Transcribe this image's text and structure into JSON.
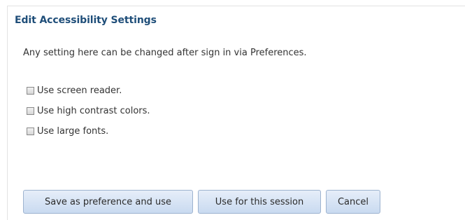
{
  "dialog": {
    "title": "Edit Accessibility Settings",
    "note": "Any setting here can be changed after sign in via Preferences."
  },
  "options": [
    {
      "label": "Use screen reader.",
      "checked": false
    },
    {
      "label": "Use high contrast colors.",
      "checked": false
    },
    {
      "label": "Use large fonts.",
      "checked": false
    }
  ],
  "buttons": {
    "save": "Save as preference and use",
    "session": "Use for this session",
    "cancel": "Cancel"
  }
}
